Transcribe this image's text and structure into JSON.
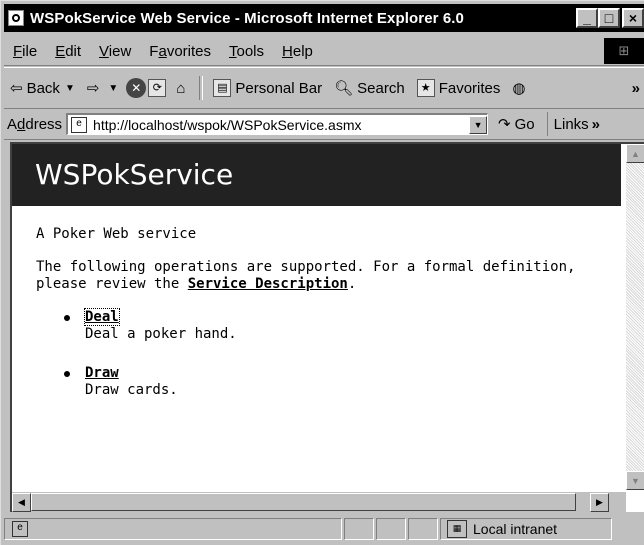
{
  "window": {
    "title": "WSPokService Web Service - Microsoft Internet Explorer 6.0",
    "controls": {
      "minimize": "_",
      "maximize": "□",
      "close": "×"
    }
  },
  "menubar": {
    "items": [
      {
        "label": "File",
        "key": "F",
        "rest": "ile"
      },
      {
        "label": "Edit",
        "key": "E",
        "rest": "dit"
      },
      {
        "label": "View",
        "key": "V",
        "rest": "iew"
      },
      {
        "label": "Favorites",
        "pre": "F",
        "key": "a",
        "rest": "vorites"
      },
      {
        "label": "Tools",
        "key": "T",
        "rest": "ools"
      },
      {
        "label": "Help",
        "key": "H",
        "rest": "elp"
      }
    ]
  },
  "toolbar": {
    "back_label": "Back",
    "personal_bar_label": "Personal Bar",
    "search_label": "Search",
    "favorites_label": "Favorites",
    "more_chevron": "»"
  },
  "addressbar": {
    "label_key": "d",
    "label_pre": "A",
    "label_rest": "dress",
    "url": "http://localhost/wspok/WSPokService.asmx",
    "go_label": "Go",
    "links_label": "Links",
    "links_chevron": "»"
  },
  "page": {
    "heading": "WSPokService",
    "description": "A Poker Web service",
    "ops_intro": "The following operations are supported. For a formal definition, please review the ",
    "service_description_link": "Service Description",
    "ops_intro_end": ".",
    "operations": [
      {
        "name": "Deal",
        "description": "Deal a poker hand."
      },
      {
        "name": "Draw",
        "description": "Draw cards."
      }
    ]
  },
  "statusbar": {
    "zone": "Local intranet"
  },
  "icons": {
    "back": "back-arrow-icon",
    "forward": "forward-arrow-icon",
    "stop": "stop-icon",
    "refresh": "refresh-icon",
    "home": "home-icon",
    "search": "search-icon",
    "favorites": "favorites-icon",
    "media": "media-icon"
  }
}
